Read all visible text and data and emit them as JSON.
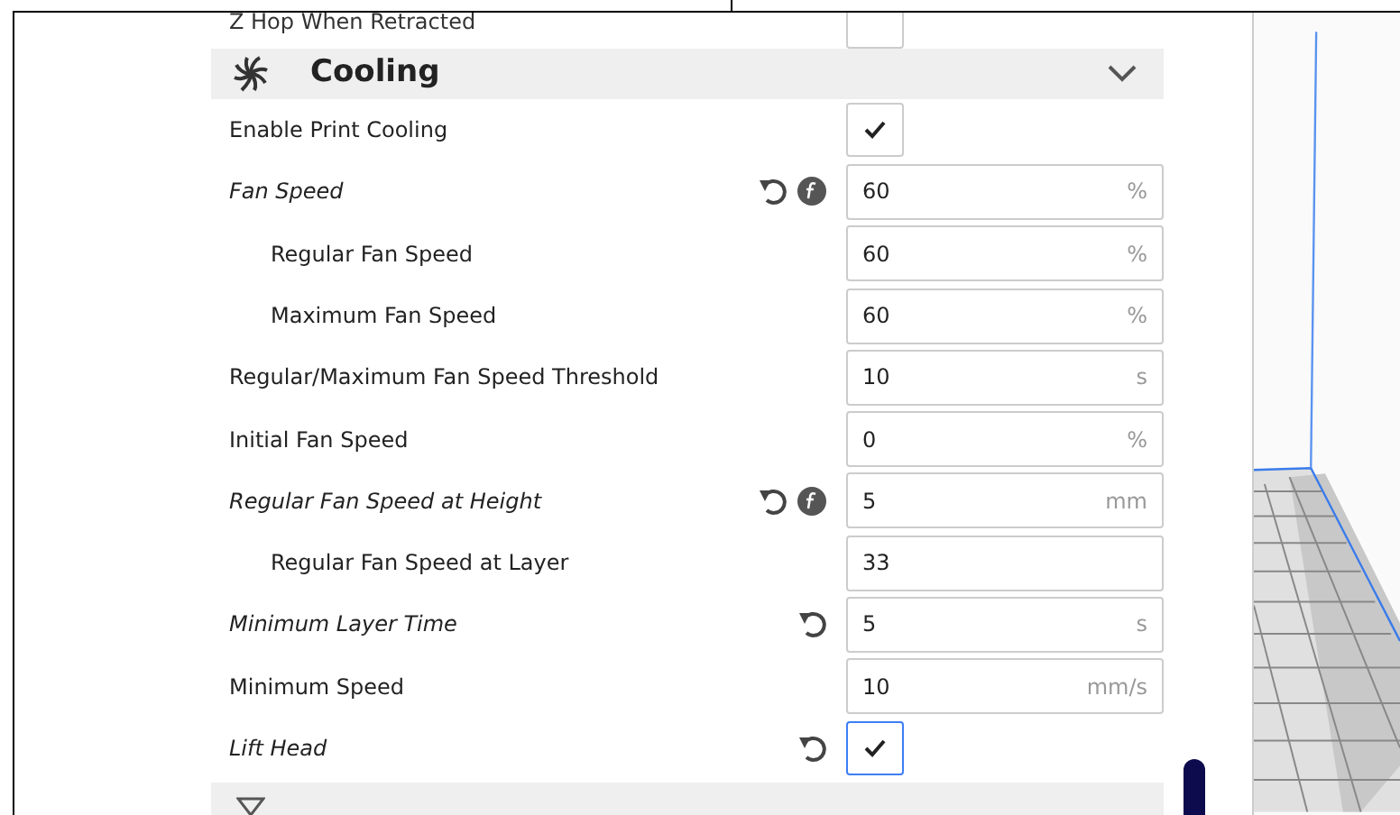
{
  "partial_setting": {
    "label": "Z Hop When Retracted",
    "kind": "checkbox",
    "checked": false
  },
  "section": {
    "title": "Cooling",
    "expanded": true
  },
  "settings": [
    {
      "label": "Enable Print Cooling",
      "kind": "checkbox",
      "checked": true,
      "modified": false,
      "resettable": false,
      "has_formula": false,
      "focused": false
    },
    {
      "label": "Fan Speed",
      "kind": "number",
      "value": "60",
      "unit": "%",
      "modified": true,
      "resettable": true,
      "has_formula": true,
      "children": [
        {
          "label": "Regular Fan Speed",
          "kind": "number",
          "value": "60",
          "unit": "%",
          "modified": false,
          "resettable": false,
          "has_formula": false
        },
        {
          "label": "Maximum Fan Speed",
          "kind": "number",
          "value": "60",
          "unit": "%",
          "modified": false,
          "resettable": false,
          "has_formula": false
        }
      ]
    },
    {
      "label": "Regular/Maximum Fan Speed Threshold",
      "kind": "number",
      "value": "10",
      "unit": "s",
      "modified": false,
      "resettable": false,
      "has_formula": false
    },
    {
      "label": "Initial Fan Speed",
      "kind": "number",
      "value": "0",
      "unit": "%",
      "modified": false,
      "resettable": false,
      "has_formula": false
    },
    {
      "label": "Regular Fan Speed at Height",
      "kind": "number",
      "value": "5",
      "unit": "mm",
      "modified": true,
      "resettable": true,
      "has_formula": true,
      "children": [
        {
          "label": "Regular Fan Speed at Layer",
          "kind": "number",
          "value": "33",
          "modified": false,
          "resettable": false,
          "has_formula": false
        }
      ]
    },
    {
      "label": "Minimum Layer Time",
      "kind": "number",
      "value": "5",
      "unit": "s",
      "modified": true,
      "resettable": true,
      "has_formula": false
    },
    {
      "label": "Minimum Speed",
      "kind": "number",
      "value": "10",
      "unit": "mm/s",
      "modified": false,
      "resettable": false,
      "has_formula": false
    },
    {
      "label": "Lift Head",
      "kind": "checkbox",
      "checked": true,
      "modified": true,
      "resettable": true,
      "has_formula": false,
      "focused": true
    }
  ]
}
